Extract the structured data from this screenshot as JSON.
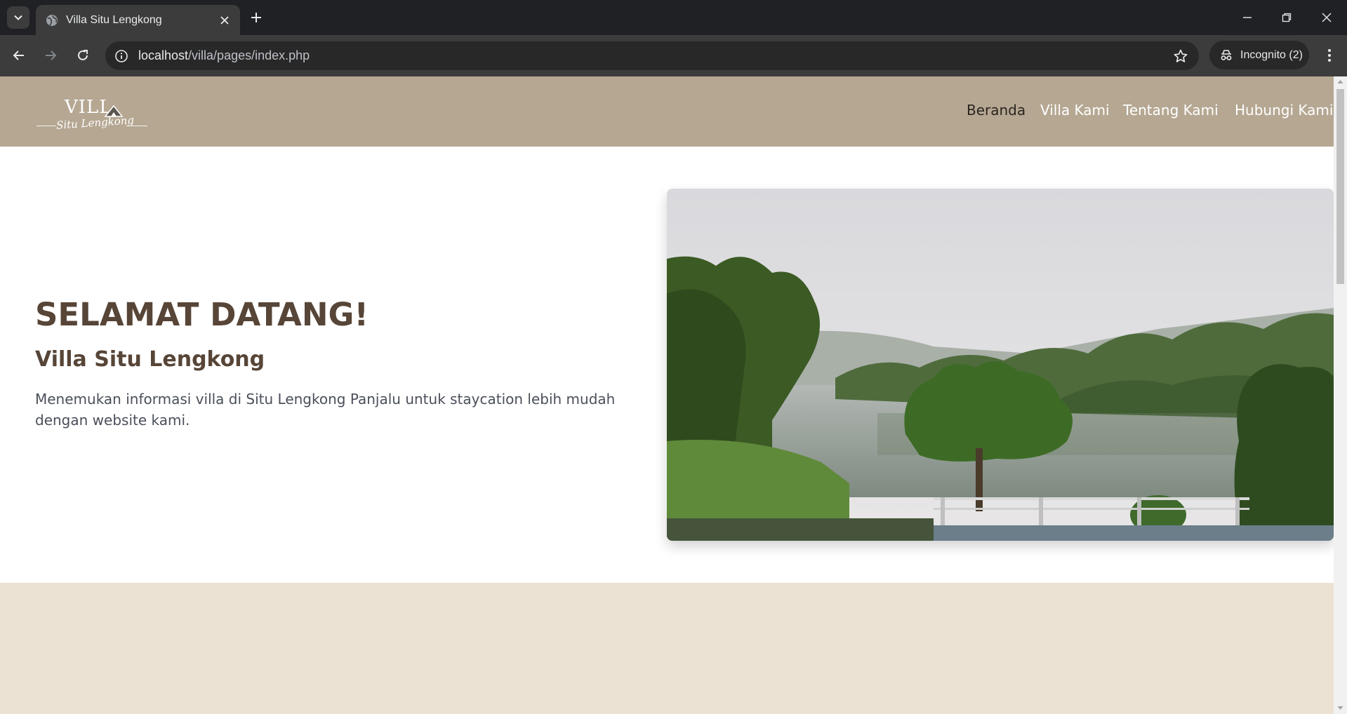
{
  "browser": {
    "tab_title": "Villa Situ Lengkong",
    "url_host": "localhost",
    "url_path": "/villa/pages/index.php",
    "incognito_label": "Incognito (2)"
  },
  "site": {
    "logo_word": "VILL",
    "logo_script": "Situ Lengkong",
    "nav": [
      "Beranda",
      "Villa Kami",
      "Tentang Kami",
      "Hubungi Kami"
    ],
    "active_nav": "Beranda",
    "colors": {
      "header_bg": "#b5a792",
      "title": "#574537",
      "body_text": "#4a4f5a",
      "section_bg": "#ebe2d4"
    }
  },
  "hero": {
    "title": "SELAMAT DATANG!",
    "subtitle": "Villa Situ Lengkong",
    "description": "Menemukan informasi villa di Situ Lengkong Panjalu untuk staycation lebih mudah dengan website kami."
  }
}
